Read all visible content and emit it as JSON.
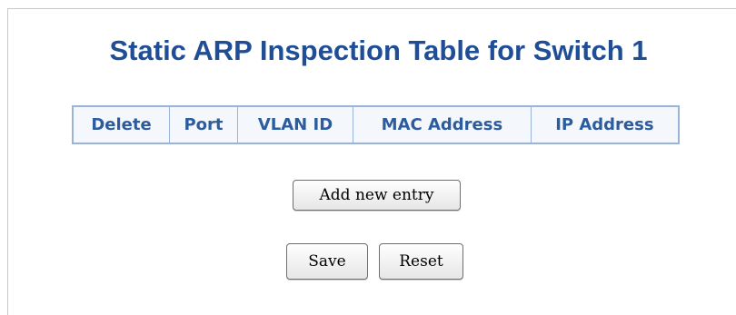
{
  "page": {
    "title": "Static ARP Inspection Table for Switch 1"
  },
  "table": {
    "columns": [
      "Delete",
      "Port",
      "VLAN ID",
      "MAC Address",
      "IP Address"
    ],
    "rows": []
  },
  "buttons": {
    "add_new_entry": "Add new entry",
    "save": "Save",
    "reset": "Reset"
  },
  "colors": {
    "title": "#1f4e97",
    "header_text": "#2c5c9e",
    "table_border": "#9ab3d7"
  }
}
